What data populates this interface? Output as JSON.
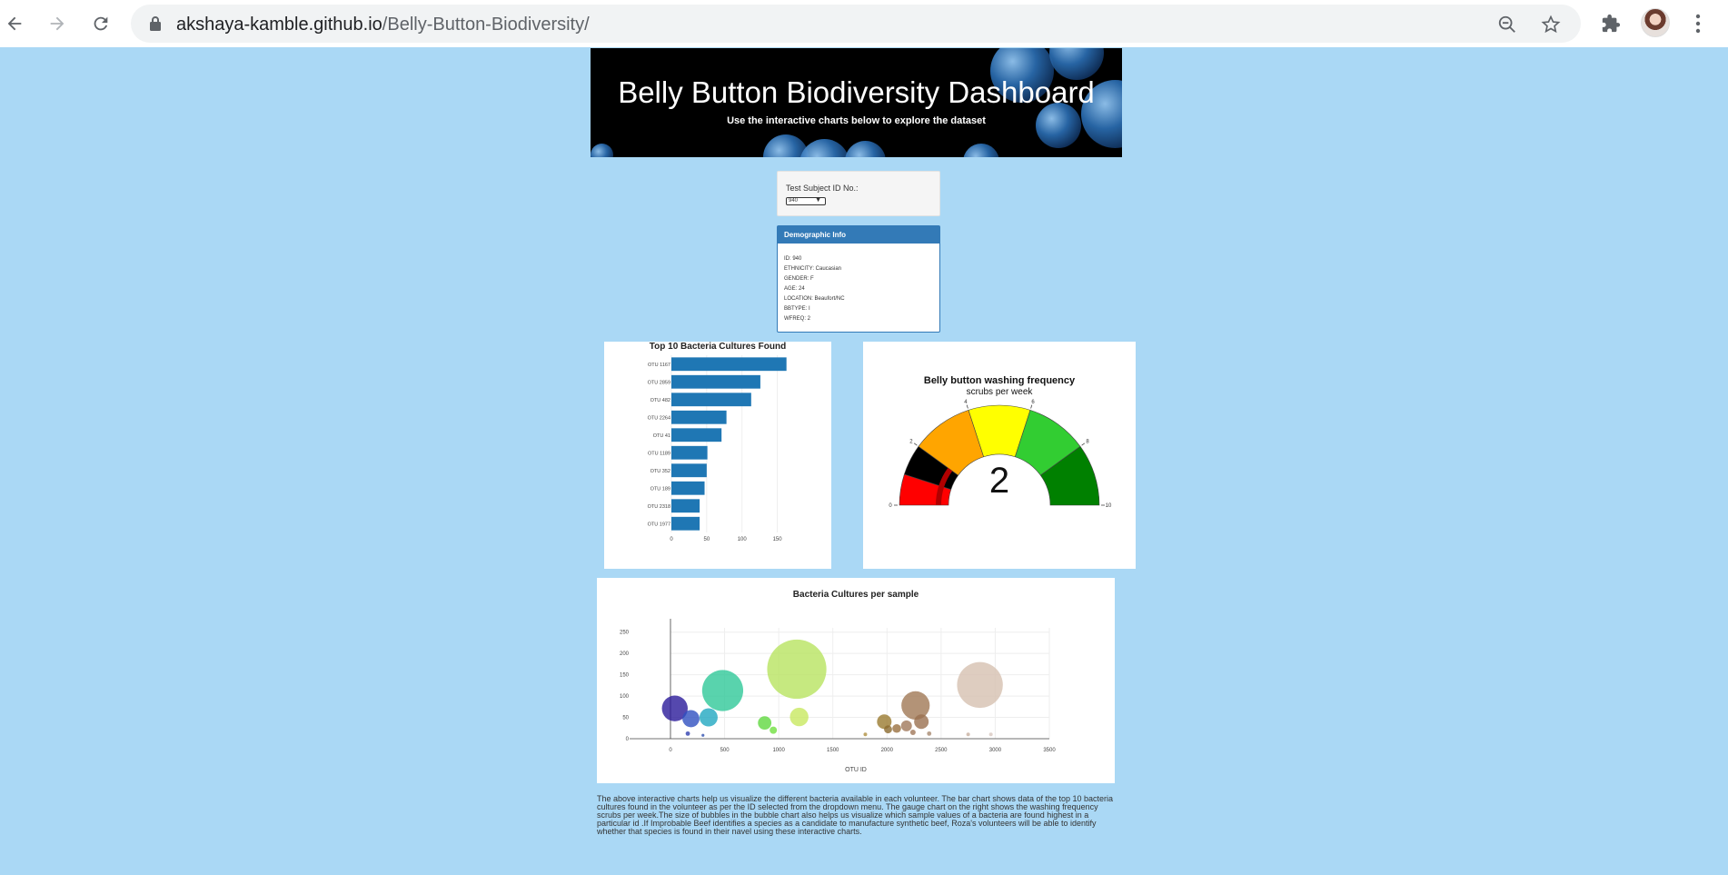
{
  "browser": {
    "url_host": "akshaya-kamble.github.io",
    "url_path": "/Belly-Button-Biodiversity/"
  },
  "header": {
    "title": "Belly Button Biodiversity Dashboard",
    "subtitle": "Use the interactive charts below to explore the dataset"
  },
  "selector": {
    "label": "Test Subject ID No.:",
    "selected": "940"
  },
  "demographic": {
    "heading": "Demographic Info",
    "rows": [
      "ID: 940",
      "ETHNICITY: Caucasian",
      "GENDER: F",
      "AGE: 24",
      "LOCATION: Beaufort/NC",
      "BBTYPE: I",
      "WFREQ: 2"
    ]
  },
  "description": "The above interactive charts help us visualize the different bacteria available in each volunteer. The bar chart shows data of the top 10 bacteria cultures found in the volunteer as per the ID selected from the dropdown menu. The gauge chart on the right shows the washing frequency scrubs per week.The size of bubbles in the bubble chart also helps us visualize which sample values of a bacteria are found highest in a particular id .If Improbable Beef identifies a species as a candidate to manufacture synthetic beef, Roza's volunteers will be able to identify whether that species is found in their navel using these interactive charts.",
  "chart_data": [
    {
      "type": "bar",
      "orientation": "horizontal",
      "title": "Top 10 Bacteria Cultures Found",
      "categories": [
        "OTU 1167",
        "OTU 2859",
        "OTU 482",
        "OTU 2264",
        "OTU 41",
        "OTU 1189",
        "OTU 352",
        "OTU 189",
        "OTU 2318",
        "OTU 1977"
      ],
      "values": [
        163,
        126,
        113,
        78,
        71,
        51,
        50,
        47,
        40,
        40
      ],
      "xticks": [
        "0",
        "50",
        "100",
        "150"
      ],
      "xlim": [
        0,
        175
      ],
      "color": "#1f77b4"
    },
    {
      "type": "gauge",
      "title": "Belly button washing frequency",
      "subtitle": "scrubs per week",
      "value": 2,
      "range": [
        0,
        10
      ],
      "tick_labels": [
        "0",
        "2",
        "4",
        "6",
        "8",
        "10"
      ],
      "steps": [
        {
          "range": [
            0,
            1
          ],
          "color": "#ff0000"
        },
        {
          "range": [
            1,
            2
          ],
          "color": "#000000"
        },
        {
          "range": [
            2,
            4
          ],
          "color": "#ffa500"
        },
        {
          "range": [
            4,
            6
          ],
          "color": "#ffff00"
        },
        {
          "range": [
            6,
            8
          ],
          "color": "#32cd32"
        },
        {
          "range": [
            8,
            10
          ],
          "color": "#008000"
        }
      ]
    },
    {
      "type": "scatter",
      "subtype": "bubble",
      "title": "Bacteria Cultures per sample",
      "xlabel": "OTU ID",
      "ylabel": "",
      "xlim": [
        0,
        3500
      ],
      "ylim": [
        0,
        260
      ],
      "xticks": [
        "0",
        "500",
        "1000",
        "1500",
        "2000",
        "2500",
        "3000",
        "3500"
      ],
      "yticks": [
        "0",
        "50",
        "100",
        "150",
        "200",
        "250"
      ],
      "grid": true,
      "points": [
        {
          "x": 40,
          "y": 71,
          "r": 71,
          "color": "#2a1a9a"
        },
        {
          "x": 189,
          "y": 47,
          "r": 47,
          "color": "#3050c0"
        },
        {
          "x": 352,
          "y": 50,
          "r": 50,
          "color": "#20a8c0"
        },
        {
          "x": 482,
          "y": 113,
          "r": 113,
          "color": "#30c898"
        },
        {
          "x": 870,
          "y": 37,
          "r": 37,
          "color": "#60d840"
        },
        {
          "x": 950,
          "y": 20,
          "r": 20,
          "color": "#70e040"
        },
        {
          "x": 1167,
          "y": 163,
          "r": 163,
          "color": "#b8e460"
        },
        {
          "x": 1189,
          "y": 51,
          "r": 51,
          "color": "#c8e860"
        },
        {
          "x": 160,
          "y": 12,
          "r": 12,
          "color": "#3040b0"
        },
        {
          "x": 300,
          "y": 8,
          "r": 8,
          "color": "#3050b0"
        },
        {
          "x": 1800,
          "y": 10,
          "r": 10,
          "color": "#b09040"
        },
        {
          "x": 1975,
          "y": 40,
          "r": 40,
          "color": "#9a7a30"
        },
        {
          "x": 2010,
          "y": 22,
          "r": 22,
          "color": "#8c6c30"
        },
        {
          "x": 2090,
          "y": 24,
          "r": 24,
          "color": "#9a7040"
        },
        {
          "x": 2180,
          "y": 30,
          "r": 30,
          "color": "#a0785a"
        },
        {
          "x": 2264,
          "y": 78,
          "r": 78,
          "color": "#a07855"
        },
        {
          "x": 2318,
          "y": 40,
          "r": 40,
          "color": "#9a7050"
        },
        {
          "x": 2240,
          "y": 15,
          "r": 15,
          "color": "#a0785a"
        },
        {
          "x": 2390,
          "y": 12,
          "r": 12,
          "color": "#a88a70"
        },
        {
          "x": 2750,
          "y": 10,
          "r": 10,
          "color": "#c8b0a0"
        },
        {
          "x": 2859,
          "y": 126,
          "r": 126,
          "color": "#d6c0b0"
        },
        {
          "x": 2960,
          "y": 10,
          "r": 10,
          "color": "#d8c8c0"
        }
      ]
    }
  ]
}
